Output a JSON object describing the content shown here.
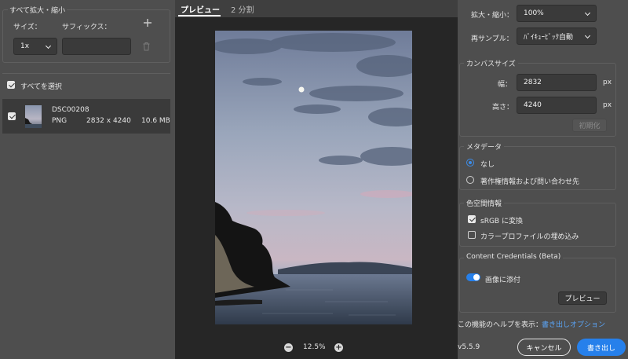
{
  "left": {
    "scale_all_title": "すべて拡大・縮小",
    "size_label": "サイズ：",
    "suffix_label": "サフィックス：",
    "add_icon": "plus-icon",
    "size_value": "1x",
    "suffix_value": "",
    "trash_icon": "trash-icon",
    "select_all_label": "すべてを選択",
    "select_all_checked": true,
    "file": {
      "name": "DSC00208",
      "format": "PNG",
      "dimensions": "2832 x 4240",
      "size": "10.6 MB",
      "checked": true
    }
  },
  "center": {
    "tabs": [
      {
        "label": "プレビュー",
        "active": true
      },
      {
        "label": "2 分割",
        "active": false
      }
    ],
    "zoom_value": "12.5%",
    "zoom_out_icon": "zoom-out-icon",
    "zoom_in_icon": "zoom-in-icon"
  },
  "right": {
    "scale_label": "拡大・縮小：",
    "scale_value": "100%",
    "resample_label": "再サンプル：",
    "resample_value": "ﾊﾞｲｷｭｰﾋﾞｯｸ自動",
    "canvas_title": "カンバスサイズ",
    "width_label": "幅：",
    "width_value": "2832",
    "height_label": "高さ：",
    "height_value": "4240",
    "unit": "px",
    "reset_button": "初期化",
    "metadata_title": "メタデータ",
    "metadata_options": [
      {
        "label": "なし",
        "selected": true
      },
      {
        "label": "著作権情報および問い合わせ先",
        "selected": false
      }
    ],
    "color_title": "色空間情報",
    "color_options": [
      {
        "label": "sRGB に変換",
        "checked": true
      },
      {
        "label": "カラープロファイルの埋め込み",
        "checked": false
      }
    ],
    "cc_title": "Content Credentials (Beta)",
    "cc_toggle_label": "画像に添付",
    "cc_toggle_on": true,
    "cc_preview_button": "プレビュー",
    "help_text": "この機能のヘルプを表示：",
    "help_link": "書き出しオプション",
    "version": "v5.5.9",
    "cancel_button": "キャンセル",
    "export_button": "書き出し"
  },
  "colors": {
    "accent": "#2680eb",
    "panel": "#4e4e4e",
    "canvas": "#262626"
  }
}
